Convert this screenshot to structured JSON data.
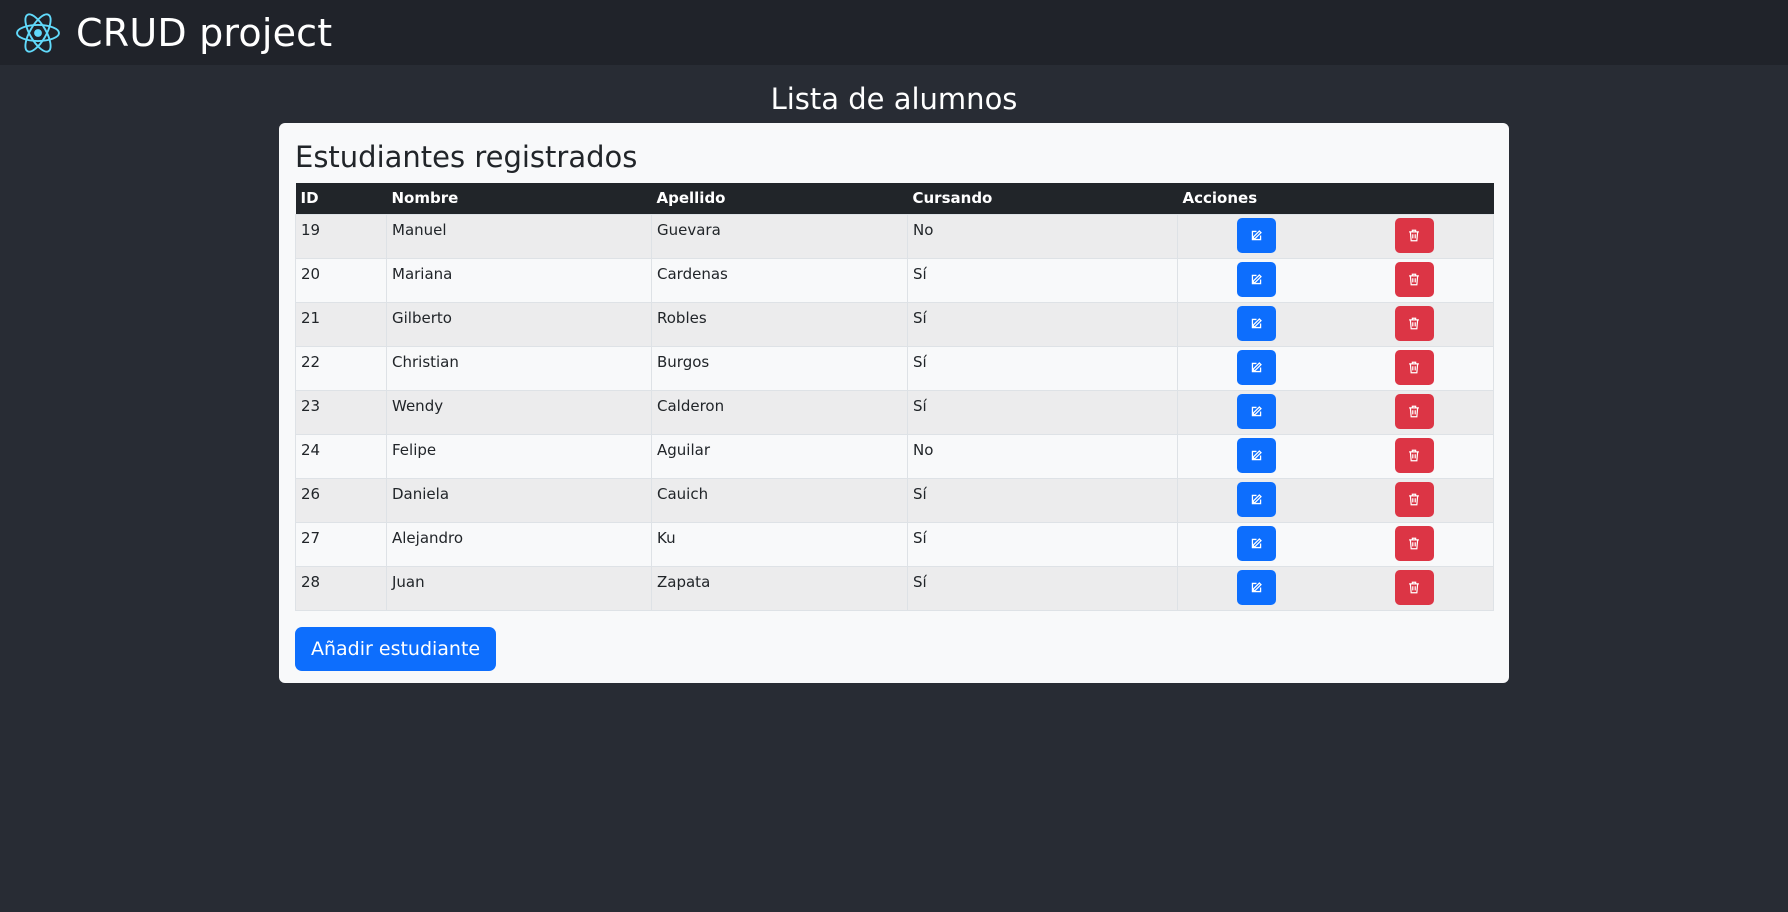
{
  "app": {
    "title": "CRUD project",
    "logo_icon": "react-logo-icon"
  },
  "page": {
    "title": "Lista de alumnos"
  },
  "card": {
    "title": "Estudiantes registrados"
  },
  "table": {
    "headers": {
      "id": "ID",
      "nombre": "Nombre",
      "apellido": "Apellido",
      "cursando": "Cursando",
      "acciones": "Acciones"
    },
    "rows": [
      {
        "id": "19",
        "nombre": "Manuel",
        "apellido": "Guevara",
        "cursando": "No"
      },
      {
        "id": "20",
        "nombre": "Mariana",
        "apellido": "Cardenas",
        "cursando": "Sí"
      },
      {
        "id": "21",
        "nombre": "Gilberto",
        "apellido": "Robles",
        "cursando": "Sí"
      },
      {
        "id": "22",
        "nombre": "Christian",
        "apellido": "Burgos",
        "cursando": "Sí"
      },
      {
        "id": "23",
        "nombre": "Wendy",
        "apellido": "Calderon",
        "cursando": "Sí"
      },
      {
        "id": "24",
        "nombre": "Felipe",
        "apellido": "Aguilar",
        "cursando": "No"
      },
      {
        "id": "26",
        "nombre": "Daniela",
        "apellido": "Cauich",
        "cursando": "Sí"
      },
      {
        "id": "27",
        "nombre": "Alejandro",
        "apellido": "Ku",
        "cursando": "Sí"
      },
      {
        "id": "28",
        "nombre": "Juan",
        "apellido": "Zapata",
        "cursando": "Sí"
      }
    ],
    "edit_icon": "edit-icon",
    "delete_icon": "trash-icon"
  },
  "actions": {
    "add_label": "Añadir estudiante"
  },
  "colors": {
    "navbar": "#20232a",
    "background": "#282c34",
    "primary": "#0d6efd",
    "danger": "#dc3545",
    "react": "#61dafb"
  }
}
